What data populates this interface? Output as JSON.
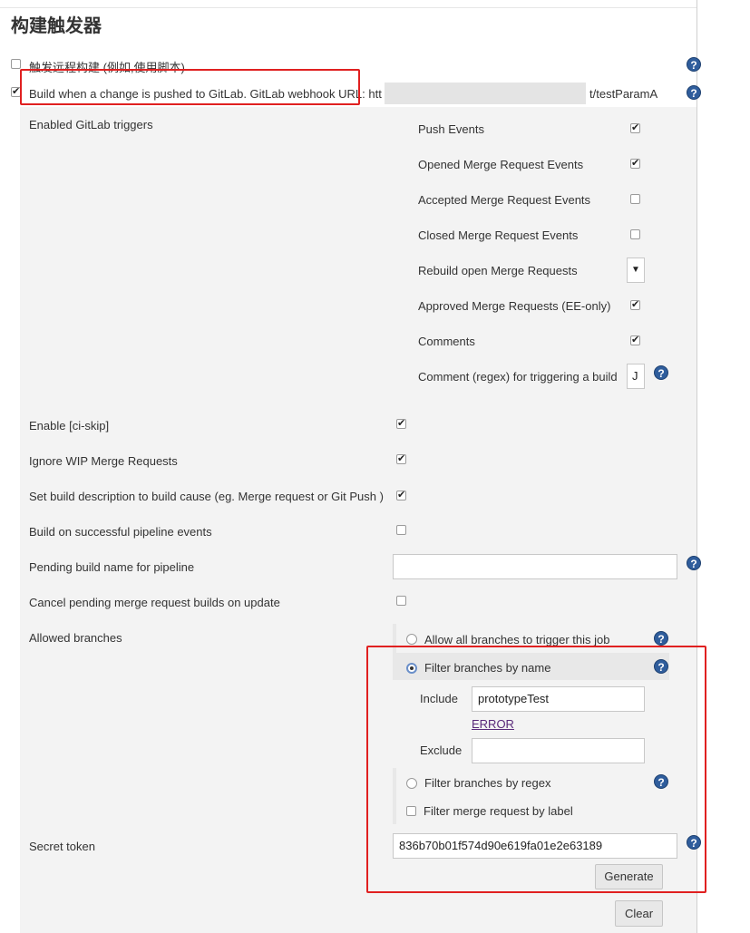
{
  "section_title": "构建触发器",
  "triggers": {
    "remote": {
      "label": "触发远程构建 (例如,使用脚本)",
      "checked": false
    },
    "gitlab": {
      "label_prefix": "Build when a change is pushed to GitLab. GitLab webhook URL: htt",
      "label_suffix": "t/testParamA",
      "checked": true
    }
  },
  "enabled_triggers_label": "Enabled GitLab triggers",
  "events": [
    {
      "label": "Push Events",
      "checked": true
    },
    {
      "label": "Opened Merge Request Events",
      "checked": true
    },
    {
      "label": "Accepted Merge Request Events",
      "checked": false
    },
    {
      "label": "Closed Merge Request Events",
      "checked": false
    },
    {
      "label": "Rebuild open Merge Requests",
      "control": "select"
    },
    {
      "label": "Approved Merge Requests (EE-only)",
      "checked": true
    },
    {
      "label": "Comments",
      "checked": true
    },
    {
      "label": "Comment (regex) for triggering a build",
      "control": "text",
      "value": "J"
    }
  ],
  "options": [
    {
      "label": "Enable [ci-skip]",
      "checked": true
    },
    {
      "label": "Ignore WIP Merge Requests",
      "checked": true
    },
    {
      "label": "Set build description to build cause (eg. Merge request or Git Push )",
      "checked": true
    },
    {
      "label": "Build on successful pipeline events",
      "checked": false
    }
  ],
  "pending_build_name_label": "Pending build name for pipeline",
  "pending_build_name_value": "",
  "cancel_pending_label": "Cancel pending merge request builds on update",
  "cancel_pending_checked": false,
  "allowed_branches": {
    "label": "Allowed branches",
    "allow_all": "Allow all branches to trigger this job",
    "filter_by_name": "Filter branches by name",
    "include_label": "Include",
    "include_value": "prototypeTest",
    "error_text": "ERROR",
    "exclude_label": "Exclude",
    "exclude_value": "",
    "filter_by_regex": "Filter branches by regex",
    "filter_mr_label": "Filter merge request by label"
  },
  "secret_token": {
    "label": "Secret token",
    "value": "836b70b01f574d90e619fa01e2e63189",
    "generate_label": "Generate"
  },
  "clear_label": "Clear",
  "help_glyph": "?",
  "select_glyph": "▼",
  "colors": {
    "highlight": "#e02020",
    "help": "#2f5d9c"
  }
}
